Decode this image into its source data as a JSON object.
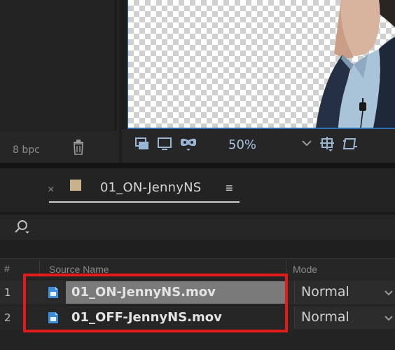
{
  "project_panel": {
    "bit_depth_label": "8 bpc",
    "icons": {
      "delete": "trash-icon"
    }
  },
  "viewer": {
    "zoom": "50%",
    "icons": {
      "snapshot": "snapshot-icon",
      "monitor": "monitor-icon",
      "mask": "mask-icon",
      "zoom_dropdown": "chevron-down-icon",
      "region": "region-of-interest-icon",
      "transparency": "transparency-grid-icon"
    }
  },
  "timeline": {
    "tab": {
      "close_glyph": "×",
      "title": "01_ON-JennyNS",
      "menu_glyph": "≡",
      "swatch_color": "#c8b28a"
    },
    "search_icon": "search-icon",
    "columns": {
      "number": "#",
      "source_name": "Source Name",
      "mode": "Mode"
    },
    "layers": [
      {
        "number": "1",
        "name": "01_ON-JennyNS.mov",
        "mode": "Normal",
        "selected": true
      },
      {
        "number": "2",
        "name": "01_OFF-JennyNS.mov",
        "mode": "Normal",
        "selected": false
      }
    ]
  },
  "colors": {
    "accent_blue": "#2f6fb0",
    "highlight_red": "#e01b1b",
    "file_icon_blue": "#3b8edb"
  }
}
